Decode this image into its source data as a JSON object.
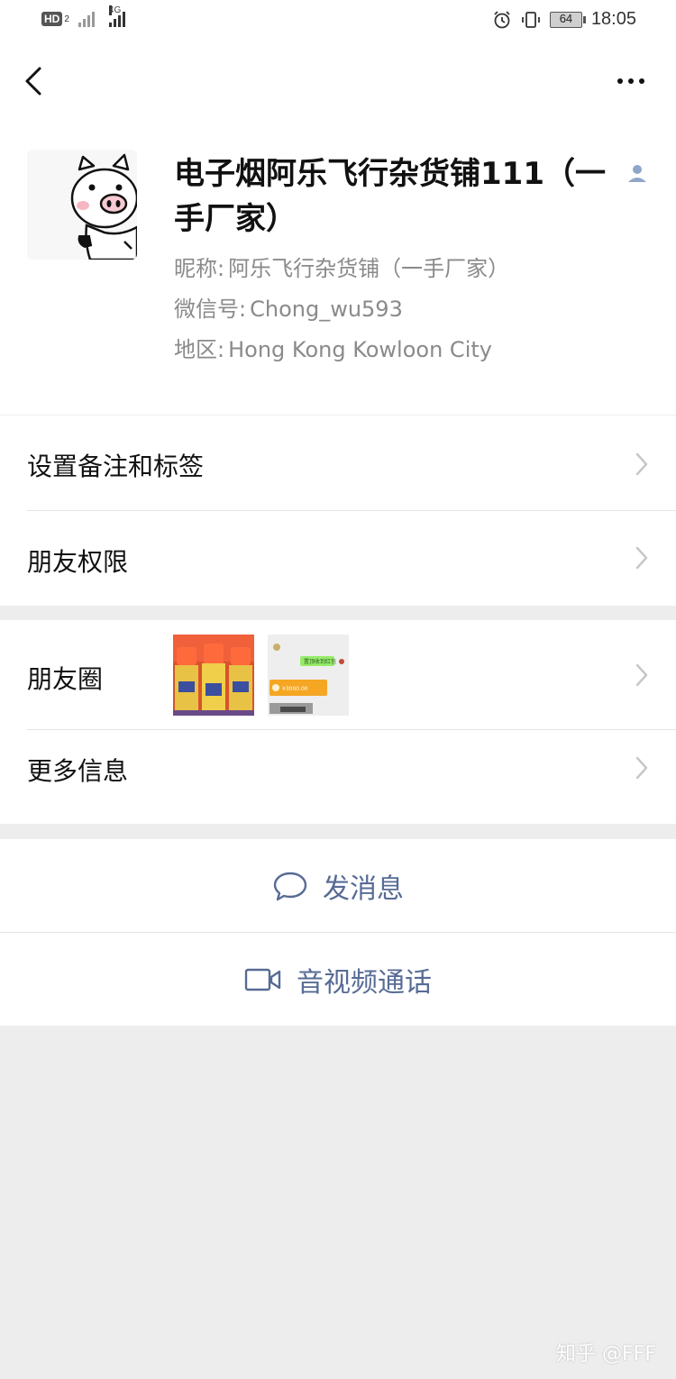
{
  "status_bar": {
    "hd_badge": "HD",
    "hd_sub": "2",
    "network_tag": "4G",
    "battery": "64",
    "time": "18:05"
  },
  "profile": {
    "name": "电子烟阿乐飞行杂货铺111（一手厂家）",
    "nickname_label": "昵称:",
    "nickname": "阿乐飞行杂货铺（一手厂家）",
    "wechat_id_label": "微信号:",
    "wechat_id": "Chong_wu593",
    "region_label": "地区:",
    "region": "Hong Kong  Kowloon City"
  },
  "rows": {
    "remarks_tags": "设置备注和标签",
    "friend_permissions": "朋友权限",
    "moments": "朋友圈",
    "more_info": "更多信息"
  },
  "actions": {
    "send_message": "发消息",
    "video_call": "音视频通话"
  },
  "moment_thumb_2_texts": [
    "置顶收到红包",
    "¥3000.00"
  ],
  "watermark": "知乎 @FFF",
  "colors": {
    "link_blue": "#576b95",
    "accent_green": "#07c160",
    "orange": "#f5a623",
    "background_gray": "#ededed"
  },
  "icons": [
    "back-arrow-icon",
    "more-dots-icon",
    "contact-person-icon",
    "chevron-right-icon",
    "chat-bubble-icon",
    "video-camera-icon"
  ]
}
